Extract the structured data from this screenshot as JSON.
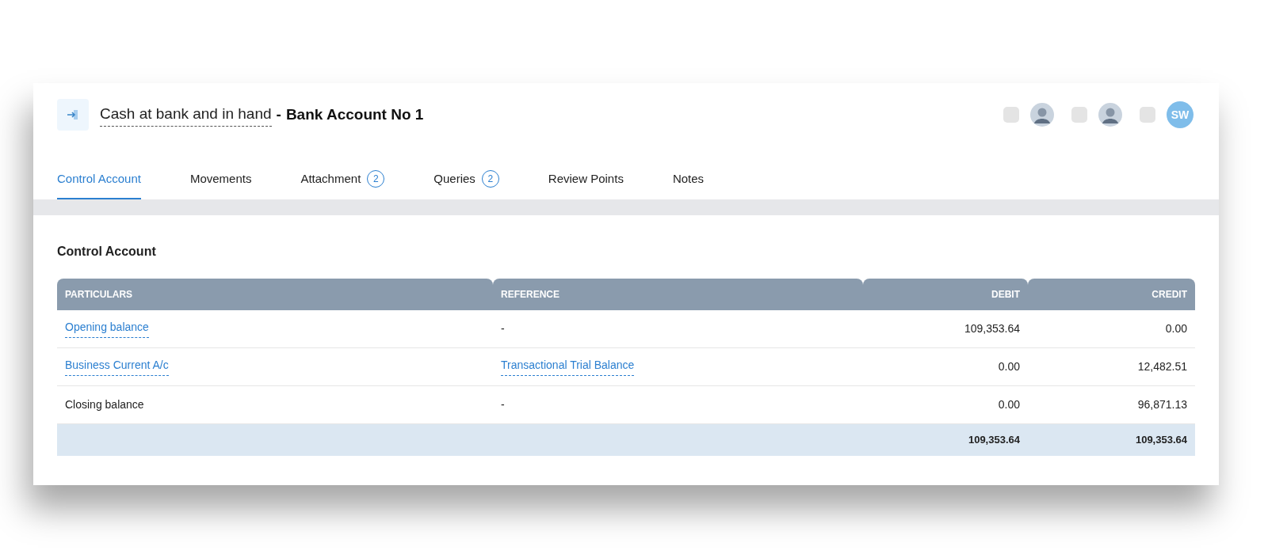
{
  "header": {
    "account": "Cash at bank and in hand",
    "separator": "-",
    "title": "Bank Account No 1"
  },
  "reviewers": [
    {
      "kind": "photo",
      "checked": false
    },
    {
      "kind": "photo",
      "checked": false
    },
    {
      "kind": "initials",
      "initials": "SW",
      "checked": false
    }
  ],
  "tabs": [
    {
      "label": "Control Account",
      "selected": true
    },
    {
      "label": "Movements",
      "selected": false
    },
    {
      "label": "Attachment",
      "badge": "2",
      "selected": false
    },
    {
      "label": "Queries",
      "badge": "2",
      "selected": false
    },
    {
      "label": "Review Points",
      "selected": false
    },
    {
      "label": "Notes",
      "selected": false
    }
  ],
  "section_title": "Control Account",
  "table": {
    "columns": [
      {
        "label": "PARTICULARS"
      },
      {
        "label": "REFERENCE"
      },
      {
        "label": "DEBIT"
      },
      {
        "label": "CREDIT"
      }
    ],
    "rows": [
      {
        "kind": "entry",
        "particulars": {
          "text": "Opening balance",
          "link": true
        },
        "reference": {
          "text": "-",
          "link": false
        },
        "debit": "109,353.64",
        "credit": "0.00"
      },
      {
        "kind": "entry",
        "particulars": {
          "text": "Business Current A/c",
          "link": true
        },
        "reference": {
          "text": "Transactional Trial Balance",
          "link": true
        },
        "debit": "0.00",
        "credit": "12,482.51"
      },
      {
        "kind": "entry",
        "particulars": {
          "text": "Closing balance",
          "link": false
        },
        "reference": {
          "text": "-",
          "link": false
        },
        "debit": "0.00",
        "credit": "96,871.13"
      },
      {
        "kind": "total",
        "debit": "109,353.64",
        "credit": "109,353.64"
      }
    ]
  }
}
